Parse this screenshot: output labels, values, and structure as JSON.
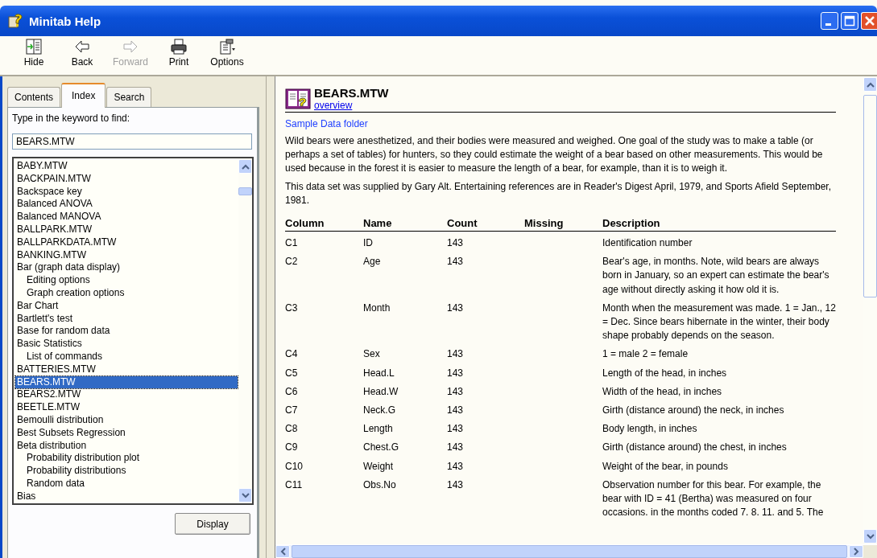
{
  "window": {
    "title": "Minitab Help"
  },
  "toolbar": [
    {
      "label": "Hide",
      "kind": "hide",
      "disabled": false
    },
    {
      "label": "Back",
      "kind": "back",
      "disabled": false
    },
    {
      "label": "Forward",
      "kind": "forward",
      "disabled": true
    },
    {
      "label": "Print",
      "kind": "print",
      "disabled": false
    },
    {
      "label": "Options",
      "kind": "options",
      "disabled": false
    }
  ],
  "tabs": [
    {
      "label": "Contents",
      "selected": false
    },
    {
      "label": "Index",
      "selected": true
    },
    {
      "label": "Search",
      "selected": false
    }
  ],
  "index": {
    "prompt": "Type in the keyword to find:",
    "value": "BEARS.MTW",
    "items": [
      {
        "label": "BABY.MTW",
        "selected": false
      },
      {
        "label": "BACKPAIN.MTW",
        "selected": false
      },
      {
        "label": "Backspace key",
        "selected": false
      },
      {
        "label": "Balanced ANOVA",
        "selected": false
      },
      {
        "label": "Balanced MANOVA",
        "selected": false
      },
      {
        "label": "BALLPARK.MTW",
        "selected": false
      },
      {
        "label": "BALLPARKDATA.MTW",
        "selected": false
      },
      {
        "label": "BANKING.MTW",
        "selected": false
      },
      {
        "label": "Bar (graph data display)",
        "selected": false,
        "children": [
          {
            "label": "Editing options",
            "selected": false
          },
          {
            "label": "Graph creation options",
            "selected": false
          }
        ]
      },
      {
        "label": "Bar Chart",
        "selected": false
      },
      {
        "label": "Bartlett's test",
        "selected": false
      },
      {
        "label": "Base for random data",
        "selected": false
      },
      {
        "label": "Basic Statistics",
        "selected": false,
        "children": [
          {
            "label": "List of commands",
            "selected": false
          }
        ]
      },
      {
        "label": "BATTERIES.MTW",
        "selected": false
      },
      {
        "label": "BEARS.MTW",
        "selected": true
      },
      {
        "label": "BEARS2.MTW",
        "selected": false
      },
      {
        "label": "BEETLE.MTW",
        "selected": false
      },
      {
        "label": "Bemoulli distribution",
        "selected": false
      },
      {
        "label": "Best Subsets Regression",
        "selected": false
      },
      {
        "label": "Beta distribution",
        "selected": false,
        "children": [
          {
            "label": "Probability distribution plot",
            "selected": false
          },
          {
            "label": "Probability distributions",
            "selected": false
          },
          {
            "label": "Random data",
            "selected": false
          }
        ]
      },
      {
        "label": "Bias",
        "selected": false
      }
    ],
    "button": "Display"
  },
  "topic": {
    "title": "BEARS.MTW",
    "subtitle_link": "overview",
    "folder_link": "Sample Data folder",
    "paragraphs": [
      "Wild bears were anesthetized, and their bodies were measured and weighed. One goal of the study was to make a table (or perhaps a set of tables) for hunters, so they could estimate the weight of a bear based on other measurements. This would be used because in the forest it is easier to measure the length of a bear, for example, than it is to weigh it.",
      "This data set was supplied by Gary Alt. Entertaining references are in Reader's Digest April, 1979, and Sports Afield September, 1981."
    ],
    "table": {
      "columns": [
        "Column",
        "Name",
        "Count",
        "Missing",
        "Description"
      ],
      "rows": [
        {
          "column": "C1",
          "name": "ID",
          "count": "143",
          "description": "Identification number"
        },
        {
          "column": "C2",
          "name": "Age",
          "count": "143",
          "description": "Bear's age, in months. Note, wild bears are always born in January, so an expert can estimate the bear's age without directly asking it how old it is."
        },
        {
          "column": "C3",
          "name": "Month",
          "count": "143",
          "description": "Month when the measurement was made. 1 = Jan., 12 = Dec. Since bears hibernate in the winter, their body shape probably depends on the season."
        },
        {
          "column": "C4",
          "name": "Sex",
          "count": "143",
          "description": "1 = male 2 = female"
        },
        {
          "column": "C5",
          "name": "Head.L",
          "count": "143",
          "description": "Length of the head, in inches"
        },
        {
          "column": "C6",
          "name": "Head.W",
          "count": "143",
          "description": "Width of the head, in inches"
        },
        {
          "column": "C7",
          "name": "Neck.G",
          "count": "143",
          "description": "Girth (distance around) the neck, in inches"
        },
        {
          "column": "C8",
          "name": "Length",
          "count": "143",
          "description": "Body length, in inches"
        },
        {
          "column": "C9",
          "name": "Chest.G",
          "count": "143",
          "description": "Girth (distance around) the chest, in inches"
        },
        {
          "column": "C10",
          "name": "Weight",
          "count": "143",
          "description": "Weight of the bear, in pounds"
        },
        {
          "column": "C11",
          "name": "Obs.No",
          "count": "143",
          "description": "Observation number for this bear. For example, the bear with ID = 41 (Bertha) was measured on four occasions. in the months coded 7. 8. 11. and 5. The"
        }
      ]
    }
  }
}
